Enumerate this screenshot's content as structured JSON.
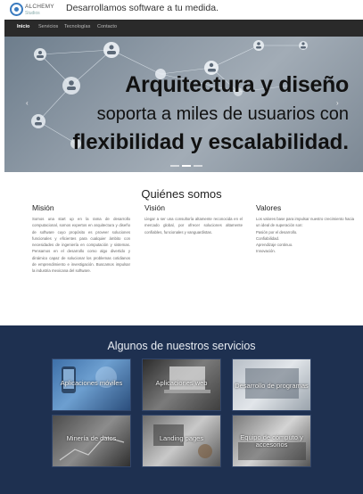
{
  "header": {
    "logo_name": "ALCHEMY",
    "logo_sub": "Studios",
    "tagline": "Desarrollamos software a tu medida."
  },
  "nav": {
    "items": [
      "Inicio",
      "Servicios",
      "Tecnologías",
      "Contacto"
    ],
    "active": "Inicio"
  },
  "hero": {
    "line1": "Arquitectura y diseño",
    "line2": "soporta a miles de usuarios con",
    "line3": "flexibilidad y escalabilidad.",
    "prev_icon": "chevron-left-icon",
    "next_icon": "chevron-right-icon",
    "slide_count": 3,
    "active_slide": 1
  },
  "about": {
    "title": "Quiénes somos",
    "mision": {
      "heading": "Misión",
      "text": "Somos una start up en la rama de desarrollo computacional, somos expertos en arquitectura y diseño de software cuyo propósito es proveer soluciones funcionales y eficientes para cualquier ámbito con necesidades de ingeniería en computación y sistemas. Pensamos en el desarrollo como algo divertido y dinámico capaz de solucionar los problemas cotidianos de emprendimiento e investigación. Buscamos impulsar la industria mexicana del software."
    },
    "vision": {
      "heading": "Visión",
      "text": "Llegar a ser una consultoría altamente reconocida en el mercado global, por ofrecer soluciones altamente confiables, funcionales y vanguardistas."
    },
    "valores": {
      "heading": "Valores",
      "intro": "Los valores base para impulsar nuestro crecimiento hacia un ideal de superación son:",
      "items": [
        "Pasión por el desarrollo.",
        "Confiabilidad.",
        "Aprendizaje continuo.",
        "Innovación."
      ]
    }
  },
  "services": {
    "title": "Algunos de nuestros servicios",
    "tiles": [
      {
        "label": "Aplicaciones móviles"
      },
      {
        "label": "Aplicaciones web"
      },
      {
        "label": "Desarrollo de programas"
      },
      {
        "label": "Minería de datos"
      },
      {
        "label": "Landing pages"
      },
      {
        "label": "Equipo de cómputo y accesorios"
      }
    ]
  },
  "colors": {
    "nav_bg": "#2a2a2a",
    "services_bg": "#1e3050",
    "logo_blue": "#3a7bbf"
  }
}
